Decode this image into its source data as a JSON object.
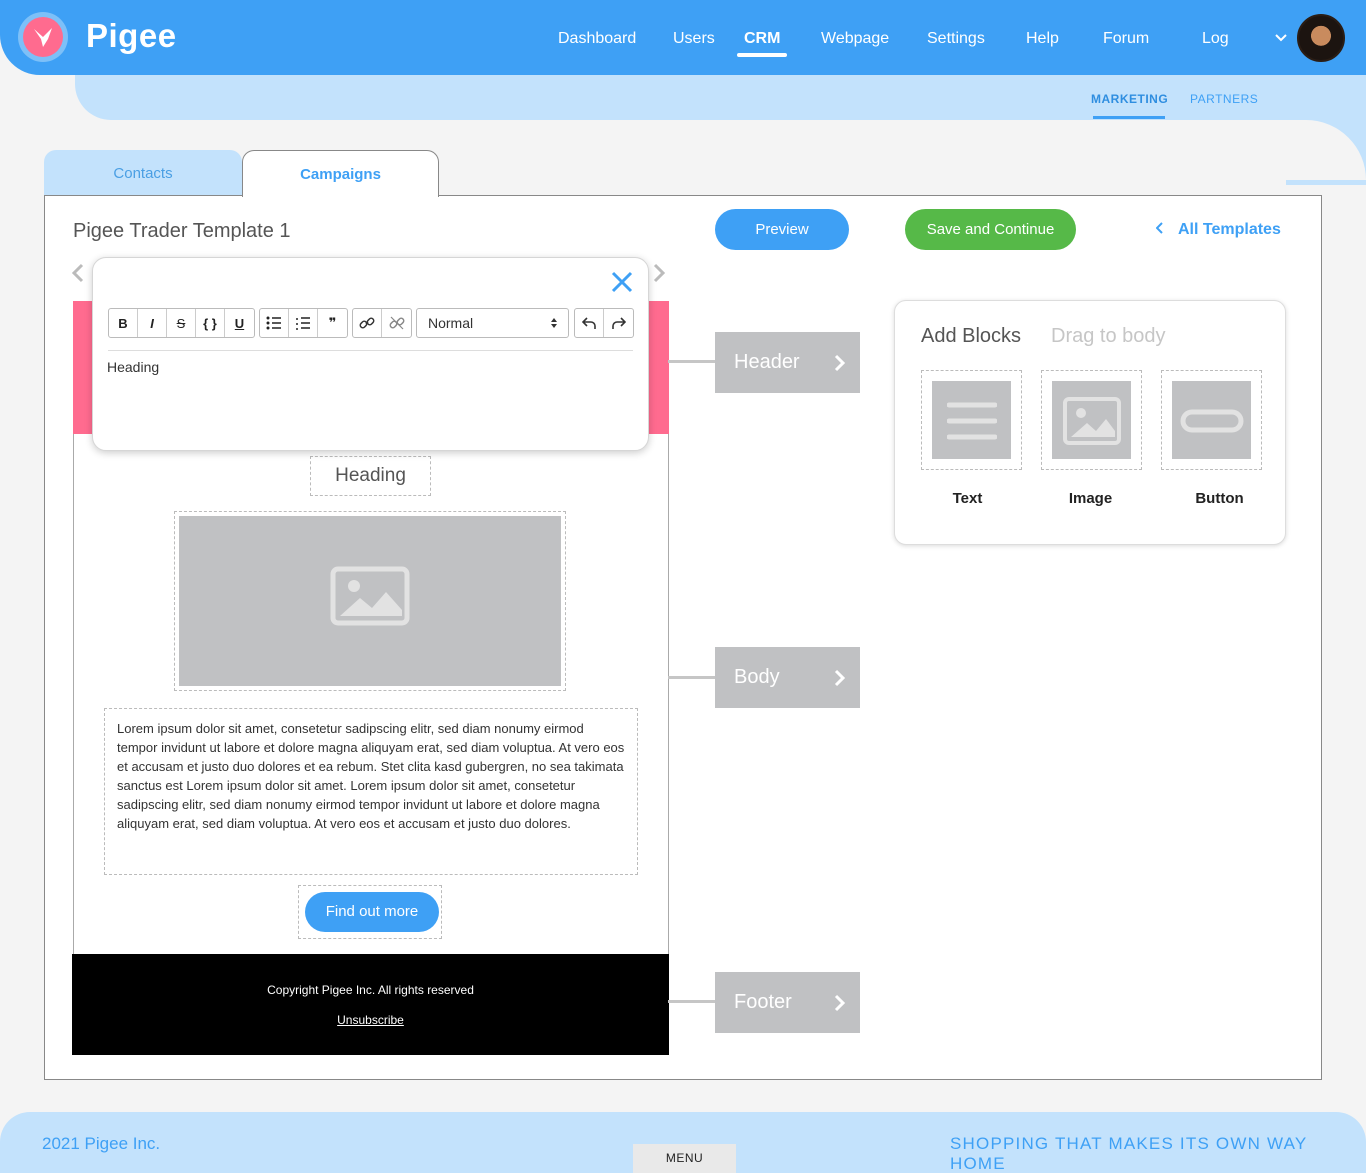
{
  "app": {
    "brand": "Pigee"
  },
  "nav": {
    "items": [
      "Dashboard",
      "Users",
      "CRM",
      "Webpage",
      "Settings",
      "Help",
      "Forum",
      "Log"
    ],
    "active": "CRM"
  },
  "subnav": {
    "items": [
      "MARKETING",
      "PARTNERS"
    ],
    "active": "MARKETING"
  },
  "tabs": {
    "contacts": "Contacts",
    "campaigns": "Campaigns",
    "active": "Campaigns"
  },
  "template": {
    "title": "Pigee Trader Template 1",
    "preview_label": "Preview",
    "save_label": "Save and Continue",
    "all_templates_label": "All Templates"
  },
  "editor": {
    "format_value": "Normal",
    "content": "Heading",
    "toolbar": [
      "bold",
      "italic",
      "strikethrough",
      "code",
      "underline",
      "bullet-list",
      "numbered-list",
      "quote",
      "link",
      "unlink",
      "undo",
      "redo"
    ]
  },
  "email": {
    "heading": "Heading",
    "body_text": "Lorem ipsum dolor sit amet, consetetur sadipscing elitr, sed diam nonumy eirmod tempor invidunt ut labore et dolore magna aliquyam erat, sed diam voluptua. At vero eos et accusam et justo duo dolores et ea rebum. Stet clita kasd gubergren, no sea takimata sanctus est Lorem ipsum dolor sit amet. Lorem ipsum dolor sit amet, consetetur sadipscing elitr, sed diam nonumy eirmod tempor invidunt ut labore et dolore magna aliquyam erat, sed diam voluptua. At vero eos et accusam et justo duo dolores.",
    "button_label": "Find out more",
    "footer_copyright": "Copyright Pigee Inc. All rights reserved",
    "footer_unsubscribe": "Unsubscribe"
  },
  "sections": {
    "header": "Header",
    "body": "Body",
    "footer": "Footer"
  },
  "blocks": {
    "title": "Add Blocks",
    "subtitle": "Drag to body",
    "items": [
      "Text",
      "Image",
      "Button"
    ]
  },
  "footer_bar": {
    "copyright": "2021 Pigee Inc.",
    "tagline": "SHOPPING THAT MAKES ITS OWN WAY HOME",
    "menu_label": "MENU"
  },
  "colors": {
    "primary": "#3ea0f5",
    "success": "#56b948",
    "header_pink": "#ff6b8f",
    "light_blue": "#c3e2fc",
    "placeholder_gray": "#c0c1c3"
  }
}
